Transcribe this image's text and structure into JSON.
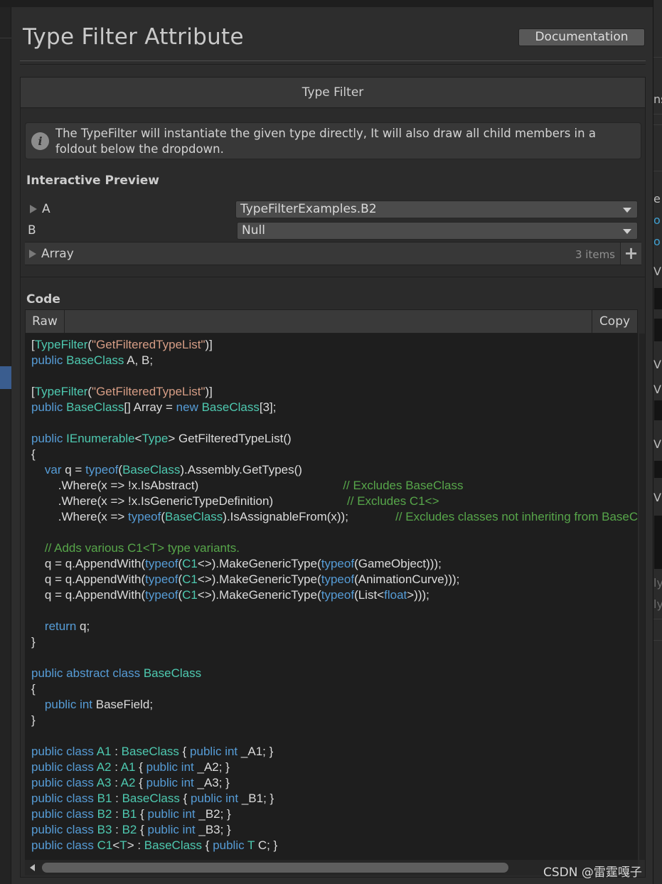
{
  "page": {
    "title": "Type Filter Attribute",
    "documentation_label": "Documentation"
  },
  "section": {
    "title": "Type Filter"
  },
  "help": {
    "text": "The TypeFilter will instantiate the given type directly, It will also draw all child members in a foldout below the dropdown."
  },
  "preview": {
    "label": "Interactive Preview",
    "fields": [
      {
        "name": "A",
        "value": "TypeFilterExamples.B2"
      },
      {
        "name": "B",
        "value": "Null"
      }
    ],
    "array": {
      "name": "Array",
      "count": "3 items"
    }
  },
  "code": {
    "label": "Code",
    "tab_raw": "Raw",
    "tab_copy": "Copy",
    "lines": [
      "[TypeFilter(\"GetFilteredTypeList\")]",
      "public BaseClass A, B;",
      "",
      "[TypeFilter(\"GetFilteredTypeList\")]",
      "public BaseClass[] Array = new BaseClass[3];",
      "",
      "public IEnumerable<Type> GetFilteredTypeList()",
      "{",
      "    var q = typeof(BaseClass).Assembly.GetTypes()",
      "        .Where(x => !x.IsAbstract)                                           // Excludes BaseClass",
      "        .Where(x => !x.IsGenericTypeDefinition)                      // Excludes C1<>",
      "        .Where(x => typeof(BaseClass).IsAssignableFrom(x));              // Excludes classes not inheriting from BaseClass",
      "",
      "    // Adds various C1<T> type variants.",
      "    q = q.AppendWith(typeof(C1<>).MakeGenericType(typeof(GameObject)));",
      "    q = q.AppendWith(typeof(C1<>).MakeGenericType(typeof(AnimationCurve)));",
      "    q = q.AppendWith(typeof(C1<>).MakeGenericType(typeof(List<float>)));",
      "",
      "    return q;",
      "}",
      "",
      "public abstract class BaseClass",
      "{",
      "    public int BaseField;",
      "}",
      "",
      "public class A1 : BaseClass { public int _A1; }",
      "public class A2 : A1 { public int _A2; }",
      "public class A3 : A2 { public int _A3; }",
      "public class B1 : BaseClass { public int _B1; }",
      "public class B2 : B1 { public int _B2; }",
      "public class B3 : B2 { public int _B3; }",
      "public class C1<T> : BaseClass { public T C; }"
    ]
  },
  "watermark": "CSDN @雷霆嘎子",
  "right_panel": {
    "fragments": [
      "ns",
      "e",
      "o",
      "o",
      "Vic",
      "Vic",
      "Vic",
      "Vic",
      "Vic",
      "Vic",
      "ly",
      "ly"
    ]
  }
}
